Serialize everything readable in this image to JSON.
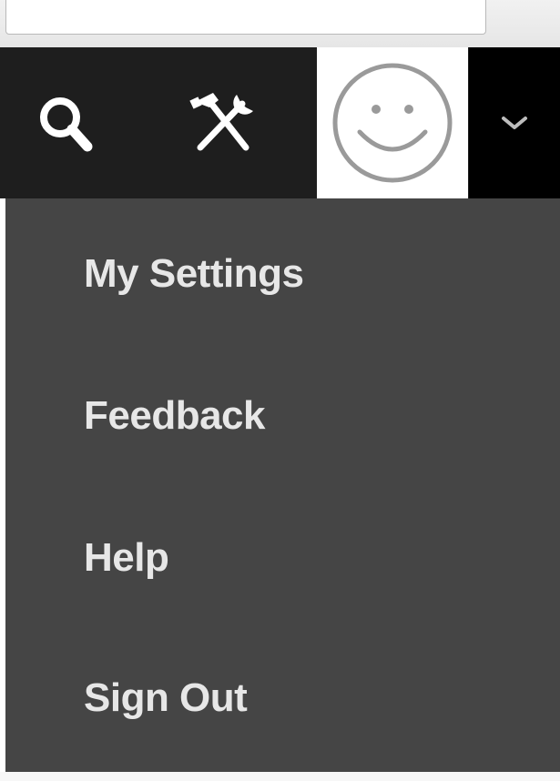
{
  "toolbar": {
    "icons": {
      "search": "search-icon",
      "tools": "hammer-wrench-icon",
      "avatar": "smiley-avatar-icon",
      "dropdown": "chevron-down-icon"
    },
    "colors": {
      "toolbar_bg": "#1e1e1e",
      "avatar_bg": "#ffffff",
      "dropdown_bg": "#000000",
      "icon_color": "#ffffff"
    }
  },
  "menu": {
    "items": [
      {
        "label": "My Settings"
      },
      {
        "label": "Feedback"
      },
      {
        "label": "Help"
      },
      {
        "label": "Sign Out"
      }
    ],
    "colors": {
      "background": "#454545",
      "text": "#e7e7e7"
    }
  }
}
